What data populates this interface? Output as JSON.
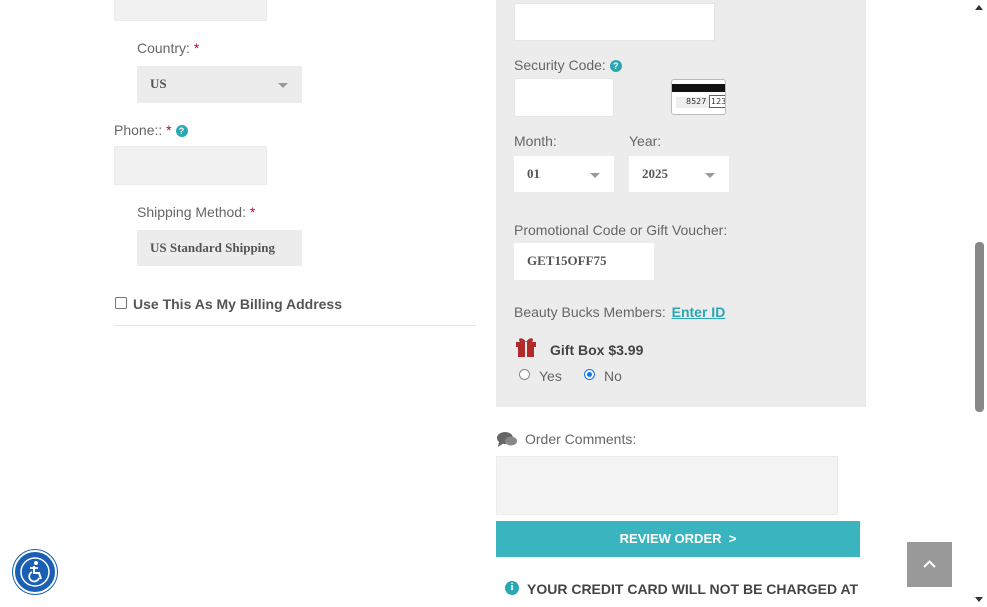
{
  "shipping": {
    "country_label": "Country:",
    "required_mark": "*",
    "country_value": "US",
    "phone_label": "Phone::",
    "shipping_method_label": "Shipping Method:",
    "shipping_method_value": "US Standard Shipping",
    "billing_checkbox_label": "Use This As My Billing Address"
  },
  "payment": {
    "security_code_label": "Security Code:",
    "card_digits": "8527",
    "card_cvv": "123",
    "month_label": "Month:",
    "month_value": "01",
    "year_label": "Year:",
    "year_value": "2025",
    "promo_label": "Promotional Code or Gift Voucher:",
    "promo_value": "GET15OFF75",
    "beauty_bucks_label": "Beauty Bucks Members:",
    "beauty_bucks_link": "Enter ID",
    "gift_box_label": "Gift Box $3.99",
    "gift_yes": "Yes",
    "gift_no": "No",
    "gift_selected": "No"
  },
  "comments": {
    "label": "Order Comments:"
  },
  "actions": {
    "review_order": "REVIEW ORDER  >"
  },
  "notice": {
    "text": "YOUR CREDIT CARD WILL NOT BE CHARGED AT"
  },
  "colors": {
    "accent": "#3ab5c0",
    "panel": "#ececec",
    "required": "#b0102c",
    "gift_icon": "#b22a2a"
  }
}
